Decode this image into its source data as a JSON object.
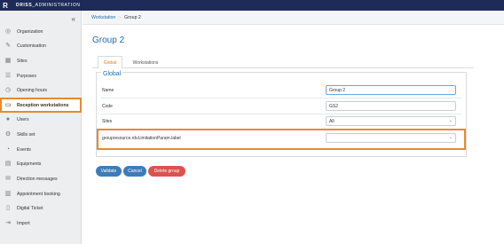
{
  "app": {
    "logo": "R",
    "brand_bold": "DRISS",
    "brand_rest": "_ADMINISTRATION"
  },
  "sidebar": {
    "collapse_glyph": "«",
    "items": [
      {
        "label": "Organization",
        "icon": "globe-icon",
        "glyph": "◎"
      },
      {
        "label": "Customisation",
        "icon": "pencil-icon",
        "glyph": "✎"
      },
      {
        "label": "Sites",
        "icon": "building-icon",
        "glyph": "▦"
      },
      {
        "label": "Purposes",
        "icon": "list-icon",
        "glyph": "☰"
      },
      {
        "label": "Opening hours",
        "icon": "clock-icon",
        "glyph": "◷"
      },
      {
        "label": "Reception workstations",
        "icon": "laptop-icon",
        "glyph": "▭"
      },
      {
        "label": "Users",
        "icon": "user-icon",
        "glyph": "●"
      },
      {
        "label": "Skills set",
        "icon": "gear-icon",
        "glyph": "⚙"
      },
      {
        "label": "Events",
        "icon": "bell-icon",
        "glyph": "◔"
      },
      {
        "label": "Equipments",
        "icon": "equipment-icon",
        "glyph": "▤"
      },
      {
        "label": "Direction messages",
        "icon": "message-icon",
        "glyph": "✉"
      },
      {
        "label": "Appointment booking",
        "icon": "calendar-icon",
        "glyph": "▥"
      },
      {
        "label": "Digital Ticket",
        "icon": "ticket-icon",
        "glyph": "▯"
      },
      {
        "label": "Import",
        "icon": "import-icon",
        "glyph": "⇥"
      }
    ]
  },
  "breadcrumb": {
    "parent": "Workstation",
    "separator": "›",
    "current": "Group 2"
  },
  "page": {
    "title": "Group 2"
  },
  "tabs": [
    {
      "label": "Global"
    },
    {
      "label": "Workstations"
    }
  ],
  "form": {
    "legend": "Global",
    "name": {
      "label": "Name",
      "value": "Group 2"
    },
    "code": {
      "label": "Code",
      "value": "GS2"
    },
    "sites": {
      "label": "Sites",
      "value": "All"
    },
    "param": {
      "label": "groupresource.rdvLimitationParam.label",
      "value": ""
    },
    "chevron": "⌄"
  },
  "actions": {
    "validate": "Validate",
    "cancel": "Cancel",
    "delete": "Delete group"
  },
  "colors": {
    "topbar": "#1e2b59",
    "link": "#1e6ab0",
    "highlight": "#e58b2f",
    "primary_button": "#3e7cb8",
    "danger_button": "#d9534f",
    "active_tab": "#e07b20"
  }
}
